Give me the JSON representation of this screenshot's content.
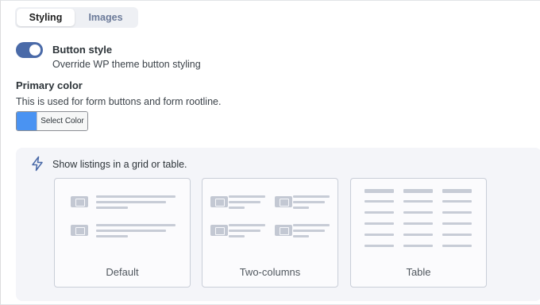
{
  "tabs": [
    {
      "label": "Styling",
      "active": true
    },
    {
      "label": "Images",
      "active": false
    }
  ],
  "button_style": {
    "title": "Button style",
    "description": "Override WP theme button styling",
    "enabled": true
  },
  "primary_color": {
    "title": "Primary color",
    "description": "This is used for form buttons and form rootline.",
    "button_label": "Select Color",
    "swatch_color": "#4a93f2"
  },
  "listings": {
    "icon": "lightning-bolt-icon",
    "description": "Show listings in a grid or table.",
    "options": [
      {
        "label": "Default"
      },
      {
        "label": "Two-columns"
      },
      {
        "label": "Table"
      }
    ]
  },
  "colors": {
    "toggle_on": "#4a6aa8",
    "panel_bg": "#f4f5f9",
    "placeholder": "#c7ccd6"
  }
}
